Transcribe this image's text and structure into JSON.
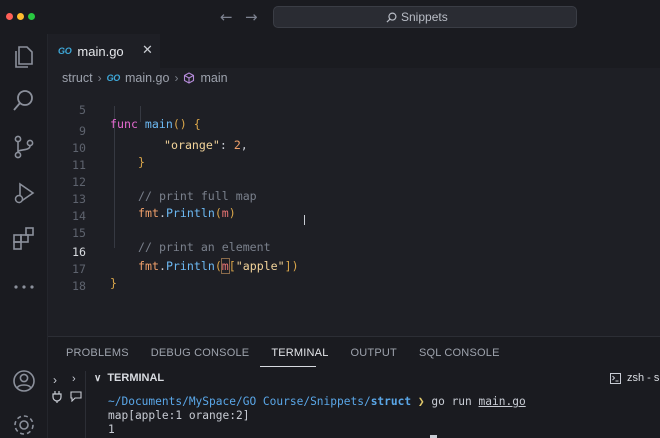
{
  "window": {
    "search_label": "Snippets",
    "traffic_colors": [
      "#ff5f57",
      "#febc2e",
      "#28c840"
    ]
  },
  "activity_icons": [
    "explorer-icon",
    "search-icon",
    "source-control-icon",
    "run-debug-icon",
    "extensions-icon",
    "more-icon",
    "account-icon",
    "settings-icon"
  ],
  "tab": {
    "badge": "GO",
    "label": "main.go",
    "close": "✕"
  },
  "breadcrumb": {
    "folder": "struct",
    "badge": "GO",
    "file": "main.go",
    "symbol": "main"
  },
  "code": {
    "lines": [
      {
        "n": "5",
        "code": "func main() {"
      },
      {
        "n": "9",
        "code": "\"orange\": 2,"
      },
      {
        "n": "10",
        "code": "}"
      },
      {
        "n": "11",
        "code": ""
      },
      {
        "n": "12",
        "code": "// print full map"
      },
      {
        "n": "13",
        "code": "fmt.Println(m)"
      },
      {
        "n": "14",
        "code": ""
      },
      {
        "n": "15",
        "code": "// print an element"
      },
      {
        "n": "16",
        "code": "fmt.Println(m[\"apple\"])"
      },
      {
        "n": "17",
        "code": "}"
      },
      {
        "n": "18",
        "code": ""
      }
    ],
    "active_line": "16"
  },
  "panel": {
    "tabs": [
      "PROBLEMS",
      "DEBUG CONSOLE",
      "TERMINAL",
      "OUTPUT",
      "SQL CONSOLE"
    ],
    "active_tab": "TERMINAL",
    "terminal_title": "TERMINAL",
    "shell": "zsh - s",
    "prompt_path": "~/Documents/MySpace/GO Course/Snippets/",
    "prompt_dir": "struct",
    "prompt_symbol": "❯",
    "command": "go run",
    "command_arg": "main.go",
    "output": [
      "map[apple:1 orange:2]",
      "1"
    ]
  }
}
